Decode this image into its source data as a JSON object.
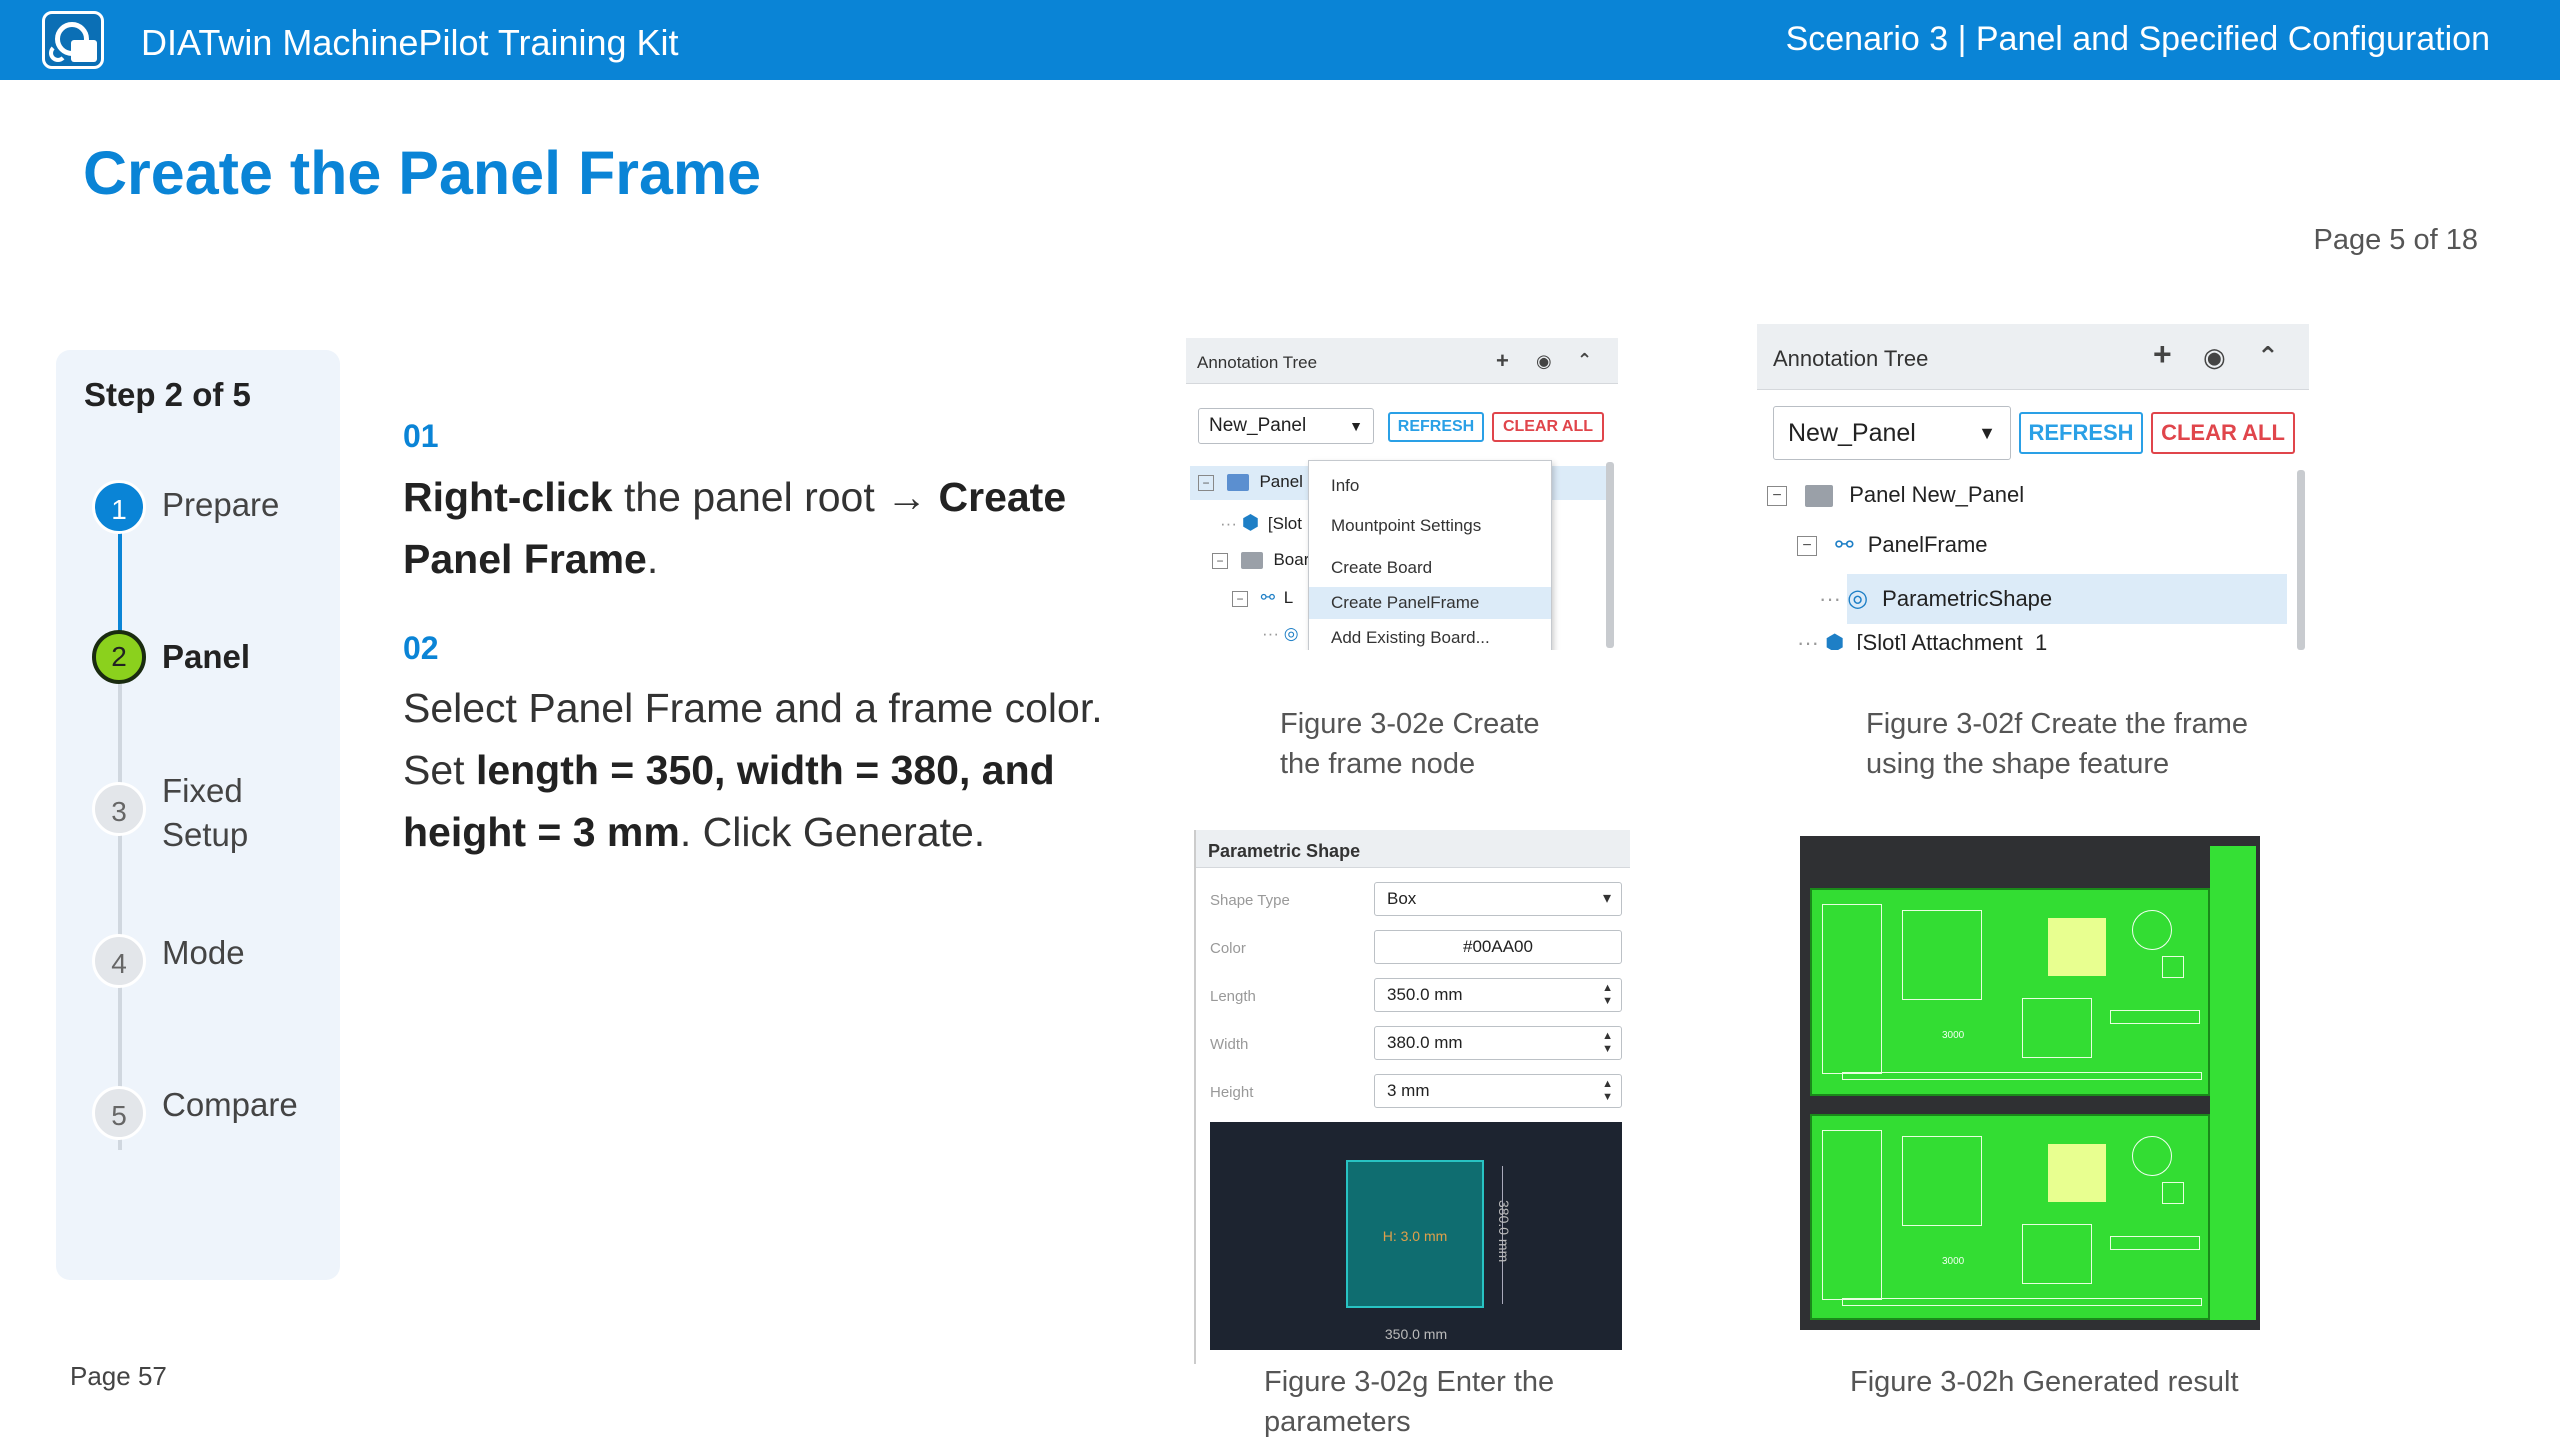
{
  "header": {
    "app_title": "DIATwin MachinePilot Training Kit",
    "scenario": "Scenario 3 | Panel and Specified Configuration"
  },
  "page_title": "Create the Panel Frame",
  "page_of": "Page 5 of 18",
  "footer_page": "Page 57",
  "stepper": {
    "title": "Step 2 of 5",
    "steps": [
      {
        "num": "1",
        "label": "Prepare"
      },
      {
        "num": "2",
        "label": "Panel"
      },
      {
        "num": "3",
        "label_line1": "Fixed",
        "label_line2": "Setup"
      },
      {
        "num": "4",
        "label": "Mode"
      },
      {
        "num": "5",
        "label": "Compare"
      }
    ]
  },
  "instructions": [
    {
      "num": "01",
      "bold1": "Right-click",
      "text1": " the panel root → ",
      "bold2": "Create Panel Frame",
      "text2": "."
    },
    {
      "num": "02",
      "text1": "Select Panel Frame and a frame color. Set ",
      "bold1": "length = 350, width = 380, and height = 3 mm",
      "text2": ". Click Generate."
    }
  ],
  "fig_e": {
    "panel_title": "Annotation Tree",
    "icons": [
      "plus-icon",
      "eye-icon",
      "chevron-up-icon"
    ],
    "select_value": "New_Panel",
    "refresh": "REFRESH",
    "clear_all": "CLEAR ALL",
    "tree": [
      "Panel",
      "[Slot",
      "Boar",
      "L"
    ],
    "menu": [
      "Info",
      "Mountpoint Settings",
      "Create Board",
      "Create PanelFrame",
      "Add Existing Board..."
    ],
    "caption_line1": "Figure 3-02e  Create",
    "caption_line2": "the frame node"
  },
  "fig_f": {
    "panel_title": "Annotation Tree",
    "select_value": "New_Panel",
    "refresh": "REFRESH",
    "clear_all": "CLEAR ALL",
    "tree": [
      "Panel  New_Panel",
      "PanelFrame",
      "ParametricShape",
      "[Slot] Attachment_1"
    ],
    "caption_line1": "Figure 3-02f  Create the frame",
    "caption_line2": "using the shape feature"
  },
  "fig_g": {
    "panel_title": "Parametric Shape",
    "fields": [
      {
        "label": "Shape Type",
        "value": "Box"
      },
      {
        "label": "Color",
        "value": "#00AA00"
      },
      {
        "label": "Length",
        "value": "350.0 mm"
      },
      {
        "label": "Width",
        "value": "380.0 mm"
      },
      {
        "label": "Height",
        "value": "3 mm"
      }
    ],
    "preview_height": "H: 3.0 mm",
    "preview_right": "380.0 mm",
    "preview_bottom": "350.0 mm",
    "caption_line1": "Figure 3-02g  Enter the",
    "caption_line2": "parameters"
  },
  "fig_h": {
    "board_text": "3000",
    "caption": "Figure 3-02h  Generated result"
  },
  "colors": {
    "brand": "#0a84d6",
    "current_step": "#8bd11d",
    "board_green": "#33dd33",
    "frame_color": "#00AA00"
  }
}
